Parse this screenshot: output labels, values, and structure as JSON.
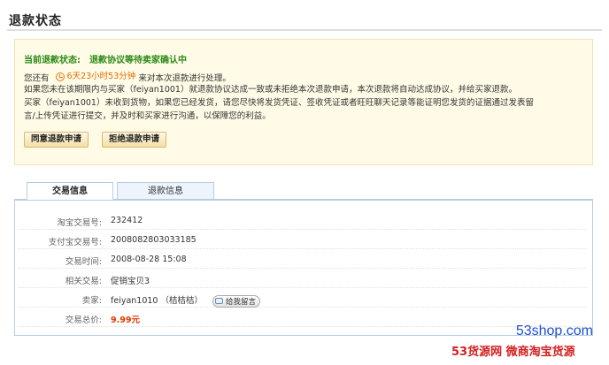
{
  "page": {
    "title": "退款状态"
  },
  "status": {
    "label": "当前退款状态:",
    "value": "退款协议等待卖家确认中",
    "line1_prefix": "您还有",
    "countdown": "6天23小时53分钟",
    "line1_suffix": "来对本次退款进行处理。",
    "line2": "如果您未在该期限内与买家（feiyan1001）就退款协议达成一致或未拒绝本次退款申请，本次退款将自动达成协议，并给买家退款。",
    "line3": "买家（feiyan1001）未收到货物，如果您已经发货，请您尽快将发货凭证、签收凭证或者旺旺聊天记录等能证明您发货的证据通过发表留",
    "line4": "言/上传凭证进行提交，并及时和买家进行沟通，以保障您的利益。",
    "agree_button": "同意退款申请",
    "refuse_button": "拒绝退款申请"
  },
  "tabs": [
    {
      "label": "交易信息",
      "active": true
    },
    {
      "label": "退款信息",
      "active": false
    }
  ],
  "details": {
    "taobao_trade_no": {
      "label": "淘宝交易号:",
      "value": "232412"
    },
    "alipay_trade_no": {
      "label": "支付宝交易号:",
      "value": "2008082803033185"
    },
    "trade_time": {
      "label": "交易时间:",
      "value": "2008-08-28 15:08"
    },
    "related_trade": {
      "label": "相关交易:",
      "value": "促销宝贝3"
    },
    "seller": {
      "label": "卖家:",
      "value": "feiyan1010 （桔桔桔）",
      "message_button": "给我留言"
    },
    "total_price": {
      "label": "交易总价:",
      "value": "9.99元"
    }
  },
  "watermark": {
    "url": "53shop.com",
    "brand": "53货源网 微商淘宝货源"
  },
  "colors": {
    "status_green": "#2b8a17",
    "countdown_orange": "#e06c00",
    "price_red": "#e03800",
    "link_blue": "#1b5fb5"
  }
}
